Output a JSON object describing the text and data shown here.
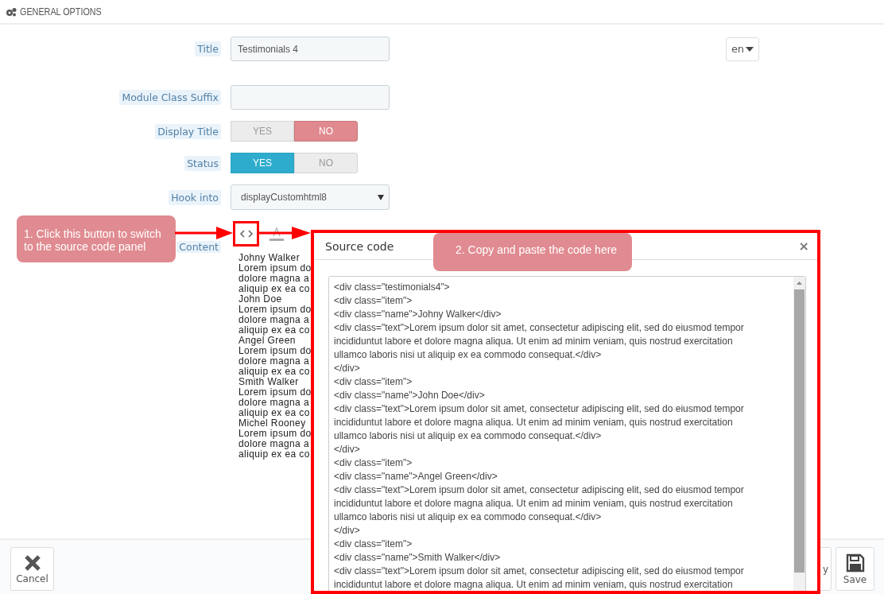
{
  "panel": {
    "title": "GENERAL OPTIONS"
  },
  "form": {
    "rows": [
      {
        "kind": "text",
        "label": "Title",
        "value": "Testimonials 4",
        "language": "en"
      },
      {
        "kind": "text",
        "label": "Module Class Suffix",
        "value": ""
      },
      {
        "kind": "toggle",
        "label": "Display Title",
        "options": [
          {
            "label": "YES",
            "selected": false
          },
          {
            "label": "NO",
            "selected": true
          }
        ]
      },
      {
        "kind": "toggle",
        "label": "Status",
        "options": [
          {
            "label": "YES",
            "selected": true
          },
          {
            "label": "NO",
            "selected": false
          }
        ]
      },
      {
        "kind": "select",
        "label": "Hook into",
        "value": "displayCustomhtml8"
      },
      {
        "kind": "editor",
        "label": "Content",
        "preview": [
          "Johny Walker",
          "Lorem ipsum do",
          "dolore magna a",
          "aliquip ex ea co",
          "John Doe",
          "Lorem ipsum do",
          "dolore magna a",
          "aliquip ex ea co",
          "Angel Green",
          "Lorem ipsum do",
          "dolore magna a",
          "aliquip ex ea co",
          "Smith Walker",
          "Lorem ipsum do",
          "dolore magna a",
          "aliquip ex ea co",
          "Michel Rooney",
          "Lorem ipsum do",
          "dolore magna a",
          "aliquip ex ea co"
        ]
      }
    ]
  },
  "modal": {
    "title": "Source code",
    "close": "×",
    "code_lines": [
      "<div class=\"testimonials4\">",
      "<div class=\"item\">",
      "<div class=\"name\">Johny Walker</div>",
      "<div class=\"text\">Lorem ipsum dolor sit amet, consectetur adipiscing elit, sed do eiusmod tempor",
      "incididuntut labore et dolore magna aliqua. Ut enim ad minim veniam, quis nostrud exercitation",
      "ullamco laboris nisi ut aliquip ex ea commodo consequat.</div>",
      "</div>",
      "<div class=\"item\">",
      "<div class=\"name\">John Doe</div>",
      "<div class=\"text\">Lorem ipsum dolor sit amet, consectetur adipiscing elit, sed do eiusmod tempor",
      "incididuntut labore et dolore magna aliqua. Ut enim ad minim veniam, quis nostrud exercitation",
      "ullamco laboris nisi ut aliquip ex ea commodo consequat.</div>",
      "</div>",
      "<div class=\"item\">",
      "<div class=\"name\">Angel Green</div>",
      "<div class=\"text\">Lorem ipsum dolor sit amet, consectetur adipiscing elit, sed do eiusmod tempor",
      "incididuntut labore et dolore magna aliqua. Ut enim ad minim veniam, quis nostrud exercitation",
      "ullamco laboris nisi ut aliquip ex ea commodo consequat.</div>",
      "</div>",
      "<div class=\"item\">",
      "<div class=\"name\">Smith Walker</div>",
      "<div class=\"text\">Lorem ipsum dolor sit amet, consectetur adipiscing elit, sed do eiusmod tempor",
      "incididuntut labore et dolore magna aliqua. Ut enim ad minim veniam, quis nostrud exercitation"
    ]
  },
  "callouts": [
    "1. Click this button to switch to the source code panel",
    "2. Copy and paste the code here"
  ],
  "footer": {
    "buttons": [
      {
        "kind": "cancel",
        "label": "Cancel"
      },
      {
        "kind": "partial",
        "label": "y"
      },
      {
        "kind": "save",
        "label": "Save"
      }
    ]
  }
}
